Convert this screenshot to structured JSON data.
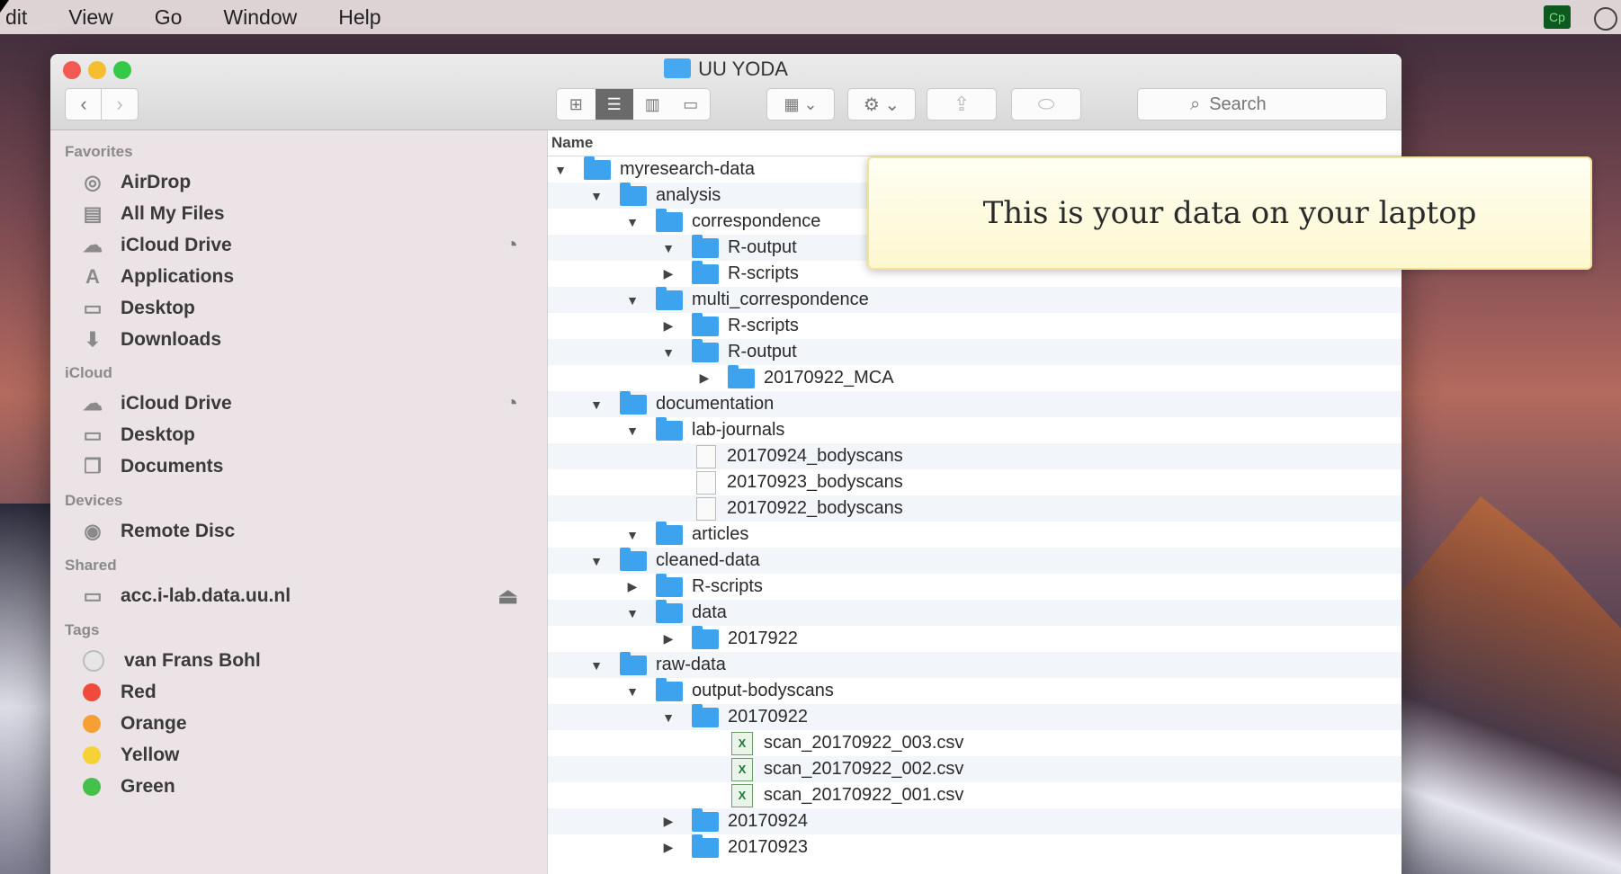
{
  "menubar": {
    "items": [
      "Edit",
      "View",
      "Go",
      "Window",
      "Help"
    ],
    "visible_items": [
      "dit",
      "View",
      "Go",
      "Window",
      "Help"
    ],
    "status_icon": "Cp"
  },
  "window": {
    "title": "UU YODA",
    "search_placeholder": "Search",
    "column_header": "Name"
  },
  "sidebar": {
    "sections": {
      "favorites": "Favorites",
      "icloud": "iCloud",
      "devices": "Devices",
      "shared": "Shared",
      "tags": "Tags"
    },
    "favorites": [
      {
        "label": "AirDrop",
        "icon": "airdrop-icon",
        "glyph": "◎"
      },
      {
        "label": "All My Files",
        "icon": "all-files-icon",
        "glyph": "▤"
      },
      {
        "label": "iCloud Drive",
        "icon": "cloud-icon",
        "glyph": "☁"
      },
      {
        "label": "Applications",
        "icon": "applications-icon",
        "glyph": "A"
      },
      {
        "label": "Desktop",
        "icon": "desktop-icon",
        "glyph": "▭"
      },
      {
        "label": "Downloads",
        "icon": "downloads-icon",
        "glyph": "⬇"
      }
    ],
    "icloud": [
      {
        "label": "iCloud Drive",
        "icon": "cloud-icon",
        "glyph": "☁"
      },
      {
        "label": "Desktop",
        "icon": "desktop-icon",
        "glyph": "▭"
      },
      {
        "label": "Documents",
        "icon": "documents-icon",
        "glyph": "❐"
      }
    ],
    "devices": [
      {
        "label": "Remote Disc",
        "icon": "disc-icon",
        "glyph": "◉"
      }
    ],
    "shared": [
      {
        "label": "acc.i-lab.data.uu.nl",
        "icon": "monitor-icon",
        "glyph": "▭"
      }
    ],
    "tags": [
      {
        "label": "van Frans Bohl",
        "color": "#e6e6e6"
      },
      {
        "label": "Red",
        "color": "#f04a3a"
      },
      {
        "label": "Orange",
        "color": "#f5a033"
      },
      {
        "label": "Yellow",
        "color": "#f7d236"
      },
      {
        "label": "Green",
        "color": "#45c04a"
      }
    ]
  },
  "files": [
    {
      "name": "myresearch-data",
      "depth": 0,
      "type": "folder",
      "state": "open"
    },
    {
      "name": "analysis",
      "depth": 1,
      "type": "folder",
      "state": "open"
    },
    {
      "name": "correspondence",
      "depth": 2,
      "type": "folder",
      "state": "open"
    },
    {
      "name": "R-output",
      "depth": 3,
      "type": "folder",
      "state": "open"
    },
    {
      "name": "R-scripts",
      "depth": 3,
      "type": "folder",
      "state": "closed"
    },
    {
      "name": "multi_correspondence",
      "depth": 2,
      "type": "folder",
      "state": "open"
    },
    {
      "name": "R-scripts",
      "depth": 3,
      "type": "folder",
      "state": "closed"
    },
    {
      "name": "R-output",
      "depth": 3,
      "type": "folder",
      "state": "open"
    },
    {
      "name": "20170922_MCA",
      "depth": 4,
      "type": "folder",
      "state": "closed"
    },
    {
      "name": "documentation",
      "depth": 1,
      "type": "folder",
      "state": "open"
    },
    {
      "name": "lab-journals",
      "depth": 2,
      "type": "folder",
      "state": "open"
    },
    {
      "name": "20170924_bodyscans",
      "depth": 3,
      "type": "doc",
      "state": "none"
    },
    {
      "name": "20170923_bodyscans",
      "depth": 3,
      "type": "doc",
      "state": "none"
    },
    {
      "name": "20170922_bodyscans",
      "depth": 3,
      "type": "doc",
      "state": "none"
    },
    {
      "name": "articles",
      "depth": 2,
      "type": "folder",
      "state": "open"
    },
    {
      "name": "cleaned-data",
      "depth": 1,
      "type": "folder",
      "state": "open"
    },
    {
      "name": "R-scripts",
      "depth": 2,
      "type": "folder",
      "state": "closed"
    },
    {
      "name": "data",
      "depth": 2,
      "type": "folder",
      "state": "open"
    },
    {
      "name": "2017922",
      "depth": 3,
      "type": "folder",
      "state": "closed"
    },
    {
      "name": "raw-data",
      "depth": 1,
      "type": "folder",
      "state": "open"
    },
    {
      "name": "output-bodyscans",
      "depth": 2,
      "type": "folder",
      "state": "open"
    },
    {
      "name": "20170922",
      "depth": 3,
      "type": "folder",
      "state": "open"
    },
    {
      "name": "scan_20170922_003.csv",
      "depth": 4,
      "type": "csv",
      "state": "none"
    },
    {
      "name": "scan_20170922_002.csv",
      "depth": 4,
      "type": "csv",
      "state": "none"
    },
    {
      "name": "scan_20170922_001.csv",
      "depth": 4,
      "type": "csv",
      "state": "none"
    },
    {
      "name": "20170924",
      "depth": 3,
      "type": "folder",
      "state": "closed"
    },
    {
      "name": "20170923",
      "depth": 3,
      "type": "folder",
      "state": "closed"
    }
  ],
  "callout": {
    "text": "This is your data on your laptop"
  },
  "colors": {
    "folder": "#3ea3ef",
    "selected_view": "#6a6a6a",
    "callout_bg": "#fdf7cf"
  }
}
